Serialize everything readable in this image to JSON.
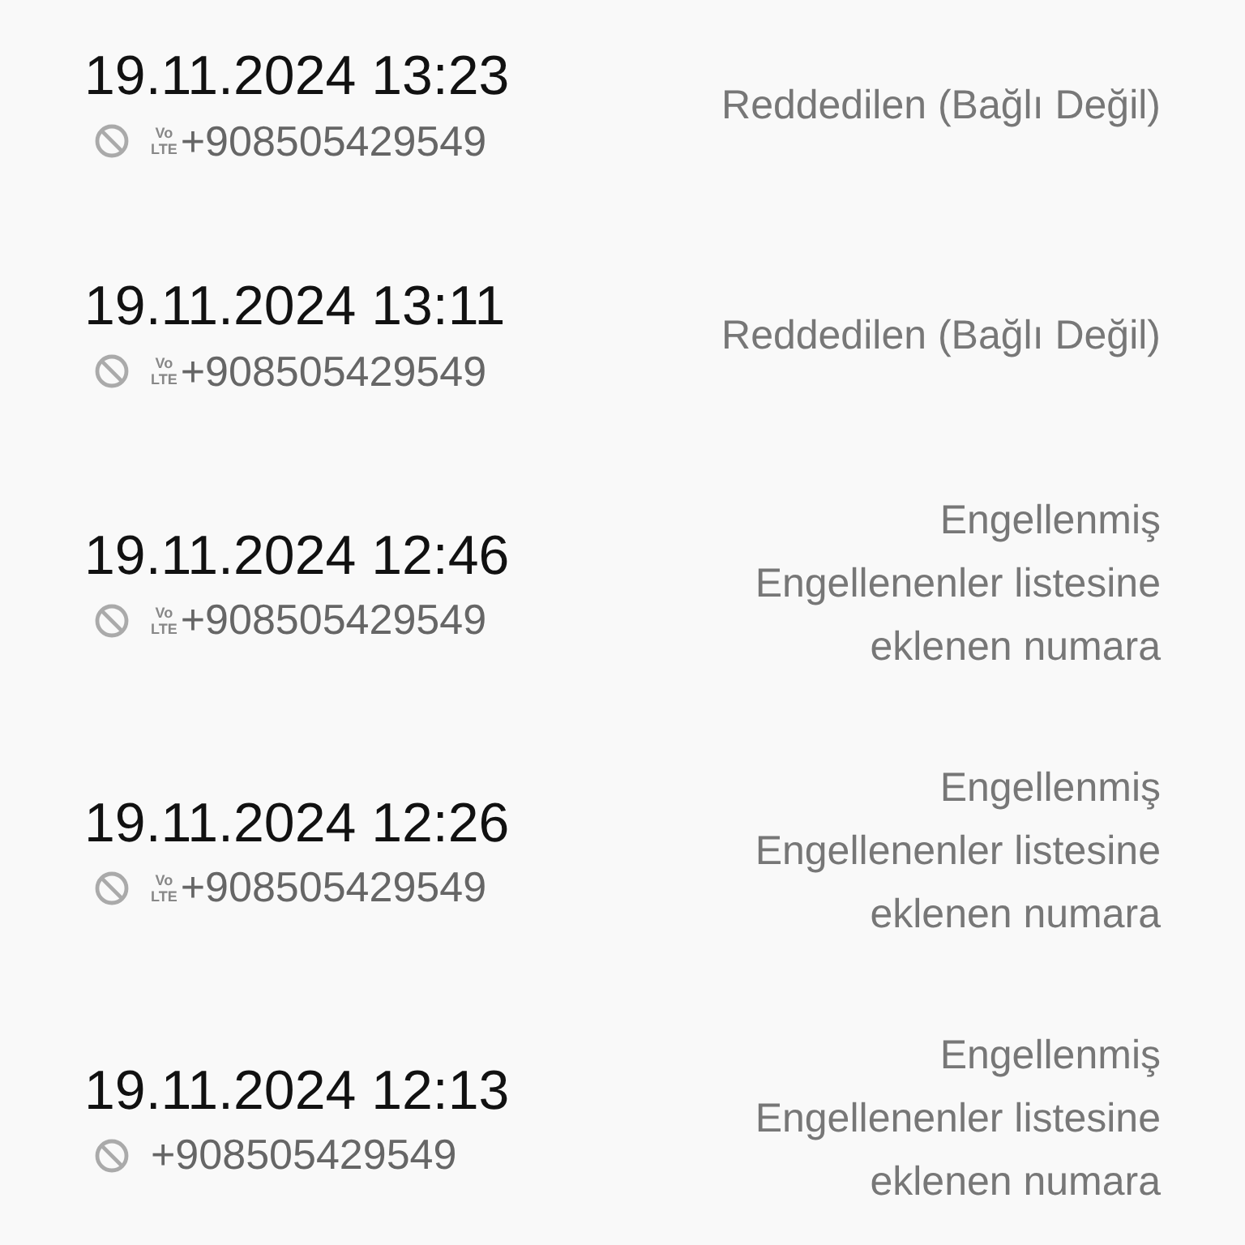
{
  "calls": [
    {
      "datetime": "19.11.2024 13:23",
      "badge": {
        "top": "Vo",
        "bottom": "LTE"
      },
      "number": "+908505429549",
      "status": [
        "Reddedilen (Bağlı Değil)"
      ]
    },
    {
      "datetime": "19.11.2024 13:11",
      "badge": {
        "top": "Vo",
        "bottom": "LTE"
      },
      "number": "+908505429549",
      "status": [
        "Reddedilen (Bağlı Değil)"
      ]
    },
    {
      "datetime": "19.11.2024 12:46",
      "badge": {
        "top": "Vo",
        "bottom": "LTE"
      },
      "number": "+908505429549",
      "status": [
        "Engellenmiş",
        "Engellenenler listesine eklenen numara"
      ]
    },
    {
      "datetime": "19.11.2024 12:26",
      "badge": {
        "top": "Vo",
        "bottom": "LTE"
      },
      "number": "+908505429549",
      "status": [
        "Engellenmiş",
        "Engellenenler listesine eklenen numara"
      ]
    },
    {
      "datetime": "19.11.2024 12:13",
      "number": "+908505429549",
      "status": [
        "Engellenmiş",
        "Engellenenler listesine eklenen numara"
      ]
    }
  ]
}
